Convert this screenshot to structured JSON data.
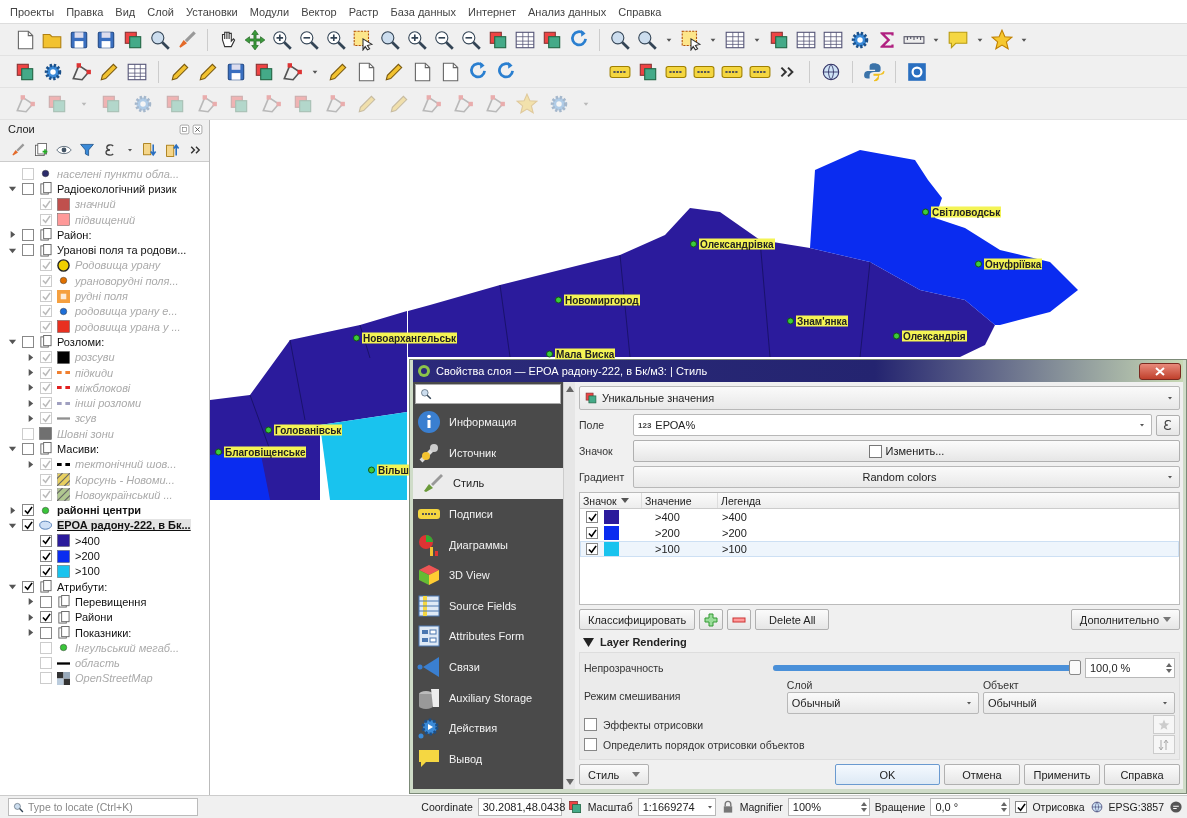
{
  "menu": [
    "Проекты",
    "Правка",
    "Вид",
    "Слой",
    "Установки",
    "Модули",
    "Вектор",
    "Растр",
    "База данных",
    "Интернет",
    "Анализ данных",
    "Справка"
  ],
  "layers_panel": {
    "title": "Слои",
    "tree": [
      {
        "label": "населені пункти обла...",
        "checked": false,
        "inactive": true,
        "bold": false,
        "selected": false,
        "kind": "dot",
        "color": "#2c2c6c"
      },
      {
        "label": "Радіоекологічний ризик",
        "checked": false,
        "inactive": false,
        "bold": false,
        "selected": false,
        "kind": "group",
        "expanded": true,
        "children": [
          {
            "label": "значний",
            "checked": true,
            "inactive": true,
            "bold": false,
            "selected": false,
            "kind": "fill",
            "color": "#c0504d"
          },
          {
            "label": "підвищений",
            "checked": true,
            "inactive": true,
            "bold": false,
            "selected": false,
            "kind": "fill",
            "color": "#ff9999"
          }
        ]
      },
      {
        "label": "Район:",
        "checked": false,
        "inactive": false,
        "bold": false,
        "selected": false,
        "kind": "group",
        "expanded": false
      },
      {
        "label": "Уранові поля та родови...",
        "checked": false,
        "inactive": false,
        "bold": false,
        "selected": false,
        "kind": "group",
        "expanded": true,
        "children": [
          {
            "label": "Родовища урану",
            "checked": true,
            "inactive": true,
            "bold": false,
            "selected": false,
            "kind": "bigdot",
            "color": "#f0d000"
          },
          {
            "label": "урановорудні поля...",
            "checked": true,
            "inactive": true,
            "bold": false,
            "selected": false,
            "kind": "dot",
            "color": "#e07000"
          },
          {
            "label": "рудні поля",
            "checked": true,
            "inactive": true,
            "bold": false,
            "selected": false,
            "kind": "glow",
            "color": "#f5a040"
          },
          {
            "label": "родовища урану е...",
            "checked": true,
            "inactive": true,
            "bold": false,
            "selected": false,
            "kind": "dot",
            "color": "#1e6fd9"
          },
          {
            "label": "родовища урана у ...",
            "checked": true,
            "inactive": true,
            "bold": false,
            "selected": false,
            "kind": "fill",
            "color": "#e83020"
          }
        ]
      },
      {
        "label": "Розломи:",
        "checked": false,
        "inactive": false,
        "bold": false,
        "selected": false,
        "kind": "group",
        "expanded": true,
        "children": [
          {
            "label": "розсуви",
            "checked": true,
            "inactive": true,
            "bold": false,
            "selected": false,
            "kind": "fill",
            "color": "#000000",
            "expanded": false
          },
          {
            "label": "підкиди",
            "checked": true,
            "inactive": true,
            "bold": false,
            "selected": false,
            "kind": "dash",
            "color": "#f08030",
            "expanded": false
          },
          {
            "label": "міжблокові",
            "checked": true,
            "inactive": true,
            "bold": false,
            "selected": false,
            "kind": "dash",
            "color": "#e02020",
            "expanded": false
          },
          {
            "label": "інші розломи",
            "checked": true,
            "inactive": true,
            "bold": false,
            "selected": false,
            "kind": "dash",
            "color": "#a0a0c0",
            "expanded": false
          },
          {
            "label": "зсув",
            "checked": true,
            "inactive": true,
            "bold": false,
            "selected": false,
            "kind": "line",
            "color": "#909090",
            "expanded": false
          }
        ]
      },
      {
        "label": "Шовні зони",
        "checked": false,
        "inactive": true,
        "bold": false,
        "selected": false,
        "kind": "fill",
        "color": "#707070"
      },
      {
        "label": "Масиви:",
        "checked": false,
        "inactive": false,
        "bold": false,
        "selected": false,
        "kind": "group",
        "expanded": true,
        "children": [
          {
            "label": "тектонічний шов...",
            "checked": true,
            "inactive": true,
            "bold": false,
            "selected": false,
            "kind": "dash",
            "color": "#000000",
            "expanded": false
          },
          {
            "label": "Корсунь - Новоми...",
            "checked": true,
            "inactive": true,
            "bold": false,
            "selected": false,
            "kind": "hatch",
            "color": "#e8d060"
          },
          {
            "label": "Новоукраїнський ...",
            "checked": true,
            "inactive": true,
            "bold": false,
            "selected": false,
            "kind": "hatch",
            "color": "#b0c890"
          }
        ]
      },
      {
        "label": "районні центри",
        "checked": true,
        "inactive": false,
        "bold": true,
        "selected": false,
        "kind": "dot",
        "color": "#3ac53a",
        "expanded": false
      },
      {
        "label": "ЕРОА радону-222, в Бк...",
        "checked": true,
        "inactive": false,
        "bold": true,
        "selected": true,
        "kind": "polygon",
        "expanded": true,
        "children": [
          {
            "label": ">400",
            "checked": true,
            "inactive": false,
            "bold": false,
            "selected": false,
            "kind": "fill",
            "color": "#2b1b9c"
          },
          {
            "label": ">200",
            "checked": true,
            "inactive": false,
            "bold": false,
            "selected": false,
            "kind": "fill",
            "color": "#0a2cf0"
          },
          {
            "label": ">100",
            "checked": true,
            "inactive": false,
            "bold": false,
            "selected": false,
            "kind": "fill",
            "color": "#19c3ee"
          }
        ]
      },
      {
        "label": "Атрибути:",
        "checked": true,
        "inactive": false,
        "bold": false,
        "selected": false,
        "kind": "group",
        "expanded": true,
        "children": [
          {
            "label": "Перевищення",
            "checked": false,
            "inactive": false,
            "bold": false,
            "selected": false,
            "kind": "group",
            "expanded": false
          },
          {
            "label": "Райони",
            "checked": true,
            "inactive": false,
            "bold": false,
            "selected": false,
            "kind": "group",
            "expanded": false
          },
          {
            "label": "Показники:",
            "checked": false,
            "inactive": false,
            "bold": false,
            "selected": false,
            "kind": "group",
            "expanded": false
          },
          {
            "label": "Інгульський мегаб...",
            "checked": false,
            "inactive": true,
            "bold": false,
            "selected": false,
            "kind": "dot",
            "color": "#3ac53a"
          },
          {
            "label": "область",
            "checked": false,
            "inactive": true,
            "bold": false,
            "selected": false,
            "kind": "line",
            "color": "#000000"
          },
          {
            "label": "OpenStreetMap",
            "checked": false,
            "inactive": true,
            "bold": false,
            "selected": false,
            "kind": "raster"
          }
        ]
      }
    ]
  },
  "map": {
    "labels": [
      "Світловодськ",
      "Олександрівка",
      "Онуфріївка",
      "Новомиргород",
      "Знам'янка",
      "Новоархангельськ",
      "Олександрія",
      "Мала Виска",
      "Голованівськ",
      "Благовіщенське",
      "Вільш"
    ]
  },
  "dialog": {
    "title": "Свойства слоя — ЕРОА радону-222, в Бк/м3: | Стиль",
    "nav": [
      {
        "label": "Информация",
        "selected": false
      },
      {
        "label": "Источник",
        "selected": false
      },
      {
        "label": "Стиль",
        "selected": true
      },
      {
        "label": "Подписи",
        "selected": false
      },
      {
        "label": "Диаграммы",
        "selected": false
      },
      {
        "label": "3D View",
        "selected": false
      },
      {
        "label": "Source Fields",
        "selected": false
      },
      {
        "label": "Attributes Form",
        "selected": false
      },
      {
        "label": "Связи",
        "selected": false
      },
      {
        "label": "Auxiliary Storage",
        "selected": false
      },
      {
        "label": "Действия",
        "selected": false
      },
      {
        "label": "Вывод",
        "selected": false
      }
    ],
    "renderer": "Уникальные значения",
    "field": {
      "label": "Поле",
      "type_tag": "123",
      "value": "ЕРОА%"
    },
    "symbol": {
      "label": "Значок",
      "button": "Изменить..."
    },
    "gradient": {
      "label": "Градиент",
      "value": "Random colors"
    },
    "table": {
      "columns": [
        "Значок",
        "Значение",
        "Легенда"
      ],
      "rows": [
        {
          "checked": true,
          "color": "#2b1b9c",
          "value": ">400",
          "legend": ">400",
          "selected": false
        },
        {
          "checked": true,
          "color": "#0a2cf0",
          "value": ">200",
          "legend": ">200",
          "selected": false
        },
        {
          "checked": true,
          "color": "#19c3ee",
          "value": ">100",
          "legend": ">100",
          "selected": true
        }
      ]
    },
    "classify": "Классифицировать",
    "delete_all": "Delete All",
    "advanced": "Дополнительно",
    "rendering": {
      "title": "Layer Rendering",
      "expanded": true,
      "opacity_label": "Непрозрачность",
      "opacity": {
        "level": 1,
        "value": "100,0 %"
      },
      "blend_label": "Режим смешивания",
      "layer": {
        "label": "Слой",
        "value": "Обычный"
      },
      "object": {
        "label": "Объект",
        "value": "Обычный"
      },
      "options": [
        {
          "label": "Эффекты отрисовки",
          "checked": false
        },
        {
          "label": "Определить порядок отрисовки объектов",
          "checked": false
        }
      ]
    },
    "style_button": "Стиль",
    "buttons": [
      {
        "label": "OK",
        "default": true
      },
      {
        "label": "Отмена",
        "default": false
      },
      {
        "label": "Применить",
        "default": false
      },
      {
        "label": "Справка",
        "default": false
      }
    ]
  },
  "status_bar": {
    "locate_placeholder": "Type to locate (Ctrl+K)",
    "coordinate_label": "Coordinate",
    "coordinate": "30.2081,48.0438",
    "scale_label": "Масштаб",
    "scale": "1:1669274",
    "magnifier_label": "Magnifier",
    "magnifier": "100%",
    "rotation_label": "Вращение",
    "rotation": "0,0 °",
    "render_label": "Отрисовка",
    "render": true,
    "crs": "EPSG:3857"
  }
}
